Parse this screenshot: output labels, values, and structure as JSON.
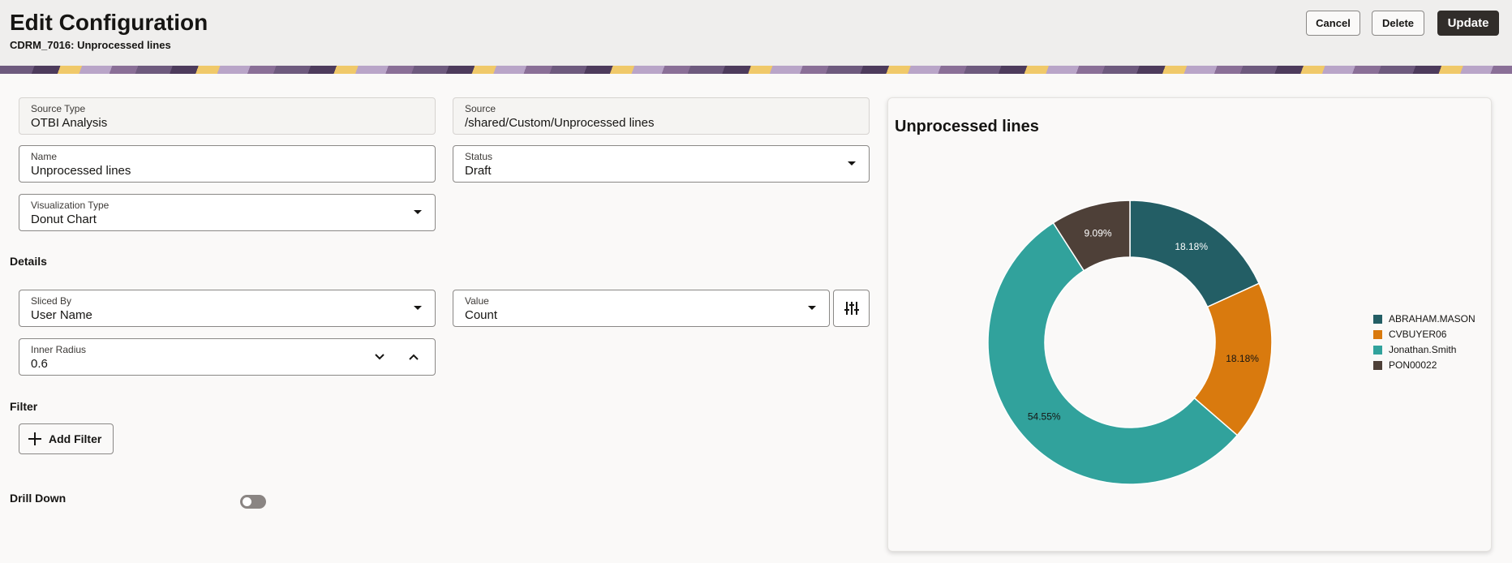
{
  "header": {
    "title": "Edit Configuration",
    "subtitle": "CDRM_7016: Unprocessed lines",
    "cancel": "Cancel",
    "delete": "Delete",
    "update": "Update"
  },
  "form": {
    "source_type": {
      "label": "Source Type",
      "value": "OTBI Analysis"
    },
    "source": {
      "label": "Source",
      "value": "/shared/Custom/Unprocessed lines"
    },
    "name": {
      "label": "Name",
      "value": "Unprocessed lines"
    },
    "status": {
      "label": "Status",
      "value": "Draft"
    },
    "vis_type": {
      "label": "Visualization Type",
      "value": "Donut Chart"
    },
    "details": "Details",
    "sliced_by": {
      "label": "Sliced By",
      "value": "User Name"
    },
    "value": {
      "label": "Value",
      "value": "Count"
    },
    "inner_radius": {
      "label": "Inner Radius",
      "value": "0.6"
    },
    "filter": "Filter",
    "add_filter": "Add Filter",
    "drill_down": "Drill Down"
  },
  "chart_data": {
    "type": "pie",
    "title": "Unprocessed lines",
    "inner_radius": 0.6,
    "categories": [
      "ABRAHAM.MASON",
      "CVBUYER06",
      "Jonathan.Smith",
      "PON00022"
    ],
    "values": [
      18.18,
      18.18,
      54.55,
      9.09
    ],
    "labels": [
      "18.18%",
      "18.18%",
      "54.55%",
      "9.09%"
    ],
    "colors": [
      "#235e65",
      "#d97a0e",
      "#31a29c",
      "#4e4038"
    ],
    "label_colors": [
      "#ffffff",
      "#161513",
      "#161513",
      "#ffffff"
    ],
    "legend": "right"
  }
}
